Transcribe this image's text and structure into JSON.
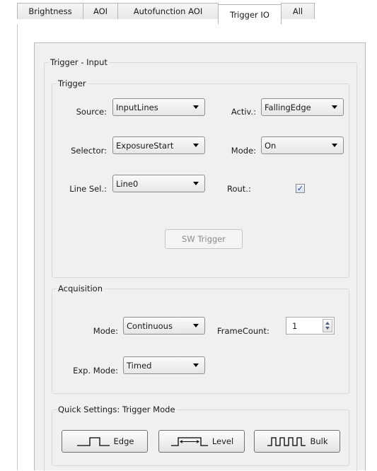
{
  "tabs": [
    {
      "label": "Brightness",
      "active": false
    },
    {
      "label": "AOI",
      "active": false
    },
    {
      "label": "Autofunction AOI",
      "active": false
    },
    {
      "label": "Trigger IO",
      "active": true
    },
    {
      "label": "All",
      "active": false
    }
  ],
  "trigger_input": {
    "title": "Trigger - Input",
    "trigger": {
      "title": "Trigger",
      "source_label": "Source:",
      "source_value": "InputLines",
      "activ_label": "Activ.:",
      "activ_value": "FallingEdge",
      "selector_label": "Selector:",
      "selector_value": "ExposureStart",
      "mode_label": "Mode:",
      "mode_value": "On",
      "line_sel_label": "Line Sel.:",
      "line_sel_value": "Line0",
      "rout_label": "Rout.:",
      "rout_checked": true,
      "check_mark": "✓",
      "sw_trigger_label": "SW Trigger"
    },
    "acquisition": {
      "title": "Acquisition",
      "mode_label": "Mode:",
      "mode_value": "Continuous",
      "framecount_label": "FrameCount:",
      "framecount_value": "1",
      "exp_mode_label": "Exp. Mode:",
      "exp_mode_value": "Timed"
    },
    "quick_settings": {
      "title": "Quick Settings: Trigger Mode",
      "edge_label": "Edge",
      "level_label": "Level",
      "bulk_label": "Bulk"
    }
  }
}
